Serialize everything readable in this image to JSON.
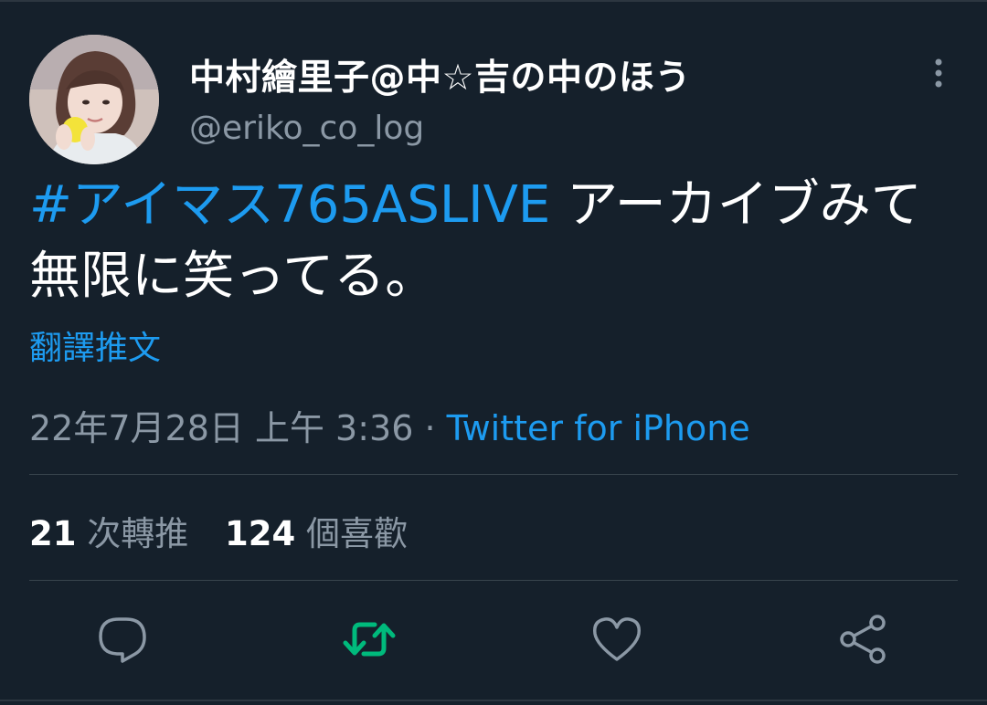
{
  "author": {
    "display_name": "中村繪里子@中☆吉の中のほう",
    "handle": "@eriko_co_log"
  },
  "tweet": {
    "hashtag": "#アイマス765ASLIVE",
    "text": " アーカイブみて無限に笑ってる。",
    "translate_label": "翻譯推文",
    "timestamp": "22年7月28日 上午 3:36",
    "separator": "·",
    "source": "Twitter for iPhone"
  },
  "stats": {
    "retweets_count": "21",
    "retweets_label": "次轉推",
    "likes_count": "124",
    "likes_label": "個喜歡"
  },
  "actions": {
    "reply_icon": "reply-icon",
    "retweet_icon": "retweet-icon",
    "like_icon": "like-icon",
    "share_icon": "share-icon"
  },
  "colors": {
    "background": "#15202b",
    "accent": "#1d9bf0",
    "retweet_active": "#00ba7c",
    "secondary_text": "#8b98a5",
    "divider": "#38444d"
  }
}
